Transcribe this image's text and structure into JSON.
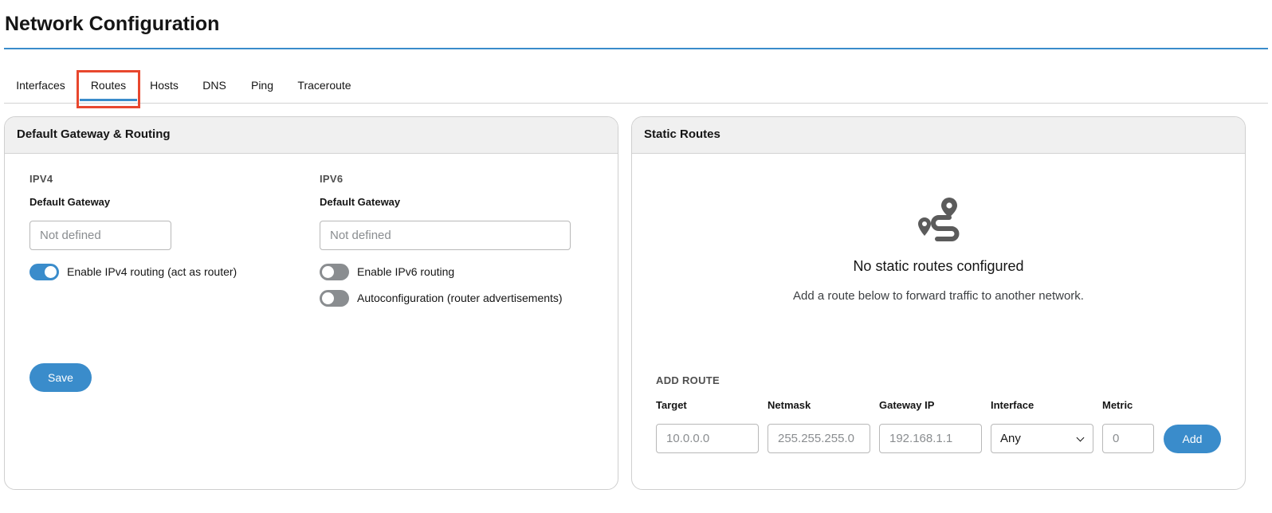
{
  "page": {
    "title": "Network Configuration"
  },
  "tabs": [
    {
      "label": "Interfaces",
      "active": false
    },
    {
      "label": "Routes",
      "active": true
    },
    {
      "label": "Hosts",
      "active": false
    },
    {
      "label": "DNS",
      "active": false
    },
    {
      "label": "Ping",
      "active": false
    },
    {
      "label": "Traceroute",
      "active": false
    }
  ],
  "gateway_card": {
    "title": "Default Gateway & Routing",
    "ipv4": {
      "section": "IPV4",
      "gateway_label": "Default Gateway",
      "gateway_placeholder": "Not defined",
      "routing_toggle": {
        "label": "Enable IPv4 routing (act as router)",
        "on": true
      }
    },
    "ipv6": {
      "section": "IPV6",
      "gateway_label": "Default Gateway",
      "gateway_placeholder": "Not defined",
      "routing_toggle": {
        "label": "Enable IPv6 routing",
        "on": false
      },
      "autoconf_toggle": {
        "label": "Autoconfiguration (router advertisements)",
        "on": false
      }
    },
    "save_label": "Save"
  },
  "static_routes_card": {
    "title": "Static Routes",
    "empty": {
      "icon": "route-icon",
      "title": "No static routes configured",
      "body": "Add a route below to forward traffic to another network."
    },
    "add_route": {
      "section": "ADD ROUTE",
      "target": {
        "label": "Target",
        "placeholder": "10.0.0.0"
      },
      "netmask": {
        "label": "Netmask",
        "placeholder": "255.255.255.0"
      },
      "gateway": {
        "label": "Gateway IP",
        "placeholder": "192.168.1.1"
      },
      "interface": {
        "label": "Interface",
        "value": "Any"
      },
      "metric": {
        "label": "Metric",
        "placeholder": "0"
      },
      "add_label": "Add"
    }
  },
  "colors": {
    "accent": "#3a8ccb",
    "highlight": "#e8472e",
    "toggle_off": "#8a8d90"
  }
}
